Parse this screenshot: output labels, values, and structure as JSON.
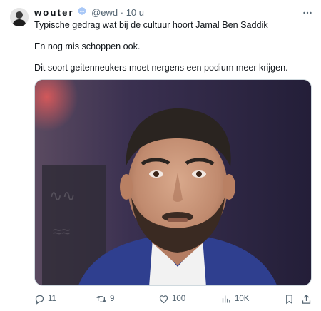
{
  "author": {
    "display_name": "wouter",
    "handle": "@ewd",
    "separator": "·",
    "time": "10 u",
    "avatar_icon": "user-avatar",
    "verified_icon": "verified-badge-icon"
  },
  "tweet": {
    "lines": [
      "Typische gedrag wat bij de cultuur hoort Jamal Ben Saddik",
      "En nog mis schoppen ook.",
      "Dit soort geitenneukers moet nergens een podium meer krijgen."
    ]
  },
  "actions": {
    "replies": "11",
    "retweets": "9",
    "likes": "100",
    "views": "10K"
  },
  "colors": {
    "text": "#0f1419",
    "muted": "#536471",
    "verified": "#8ab4f8",
    "border": "#cfd9de"
  }
}
